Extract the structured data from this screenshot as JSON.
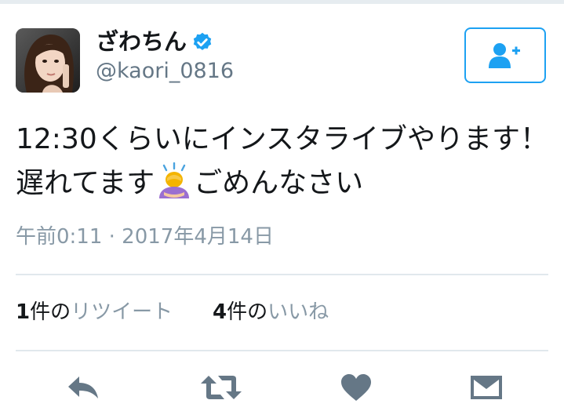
{
  "user": {
    "display_name": "ざわちん",
    "handle": "@kaori_0816",
    "verified": true
  },
  "tweet": {
    "line1": "12:30くらいにインスタライブやります！",
    "line2_before": "遅れてます",
    "emoji": "person-bowing",
    "line2_after": "ごめんなさい",
    "timestamp": "午前0:11 · 2017年4月14日"
  },
  "stats": {
    "retweets": {
      "count": "1",
      "unit": "件の",
      "label": "リツイート"
    },
    "likes": {
      "count": "4",
      "unit": "件の",
      "label": "いいね"
    }
  },
  "icons": {
    "follow": "add-user-icon",
    "reply": "reply-icon",
    "retweet": "retweet-icon",
    "like": "heart-icon",
    "dm": "envelope-icon"
  },
  "colors": {
    "accent": "#1da1f2",
    "action_icon": "#657786",
    "secondary_text": "#8899a6"
  }
}
